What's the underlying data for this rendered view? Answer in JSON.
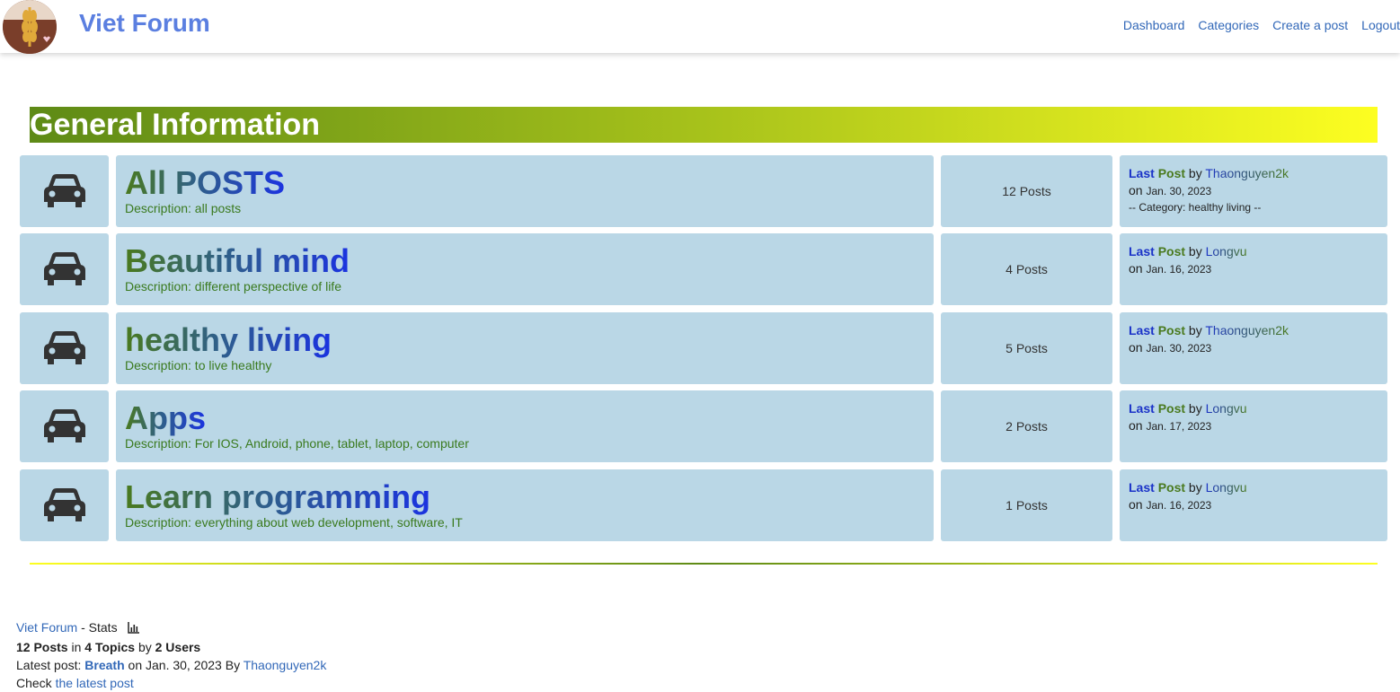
{
  "nav": {
    "brand": "Viet Forum",
    "links": [
      "Dashboard",
      "Categories",
      "Create a post",
      "Logout"
    ]
  },
  "section": {
    "title": "General Information"
  },
  "categories": [
    {
      "title": "All POSTS",
      "description": "Description: all posts",
      "count": "12 Posts",
      "last_label": "Last Post",
      "by": "by",
      "user": "Thaonguyen2k",
      "on": "on",
      "date": "Jan. 30, 2023",
      "extra": "-- Category: healthy living --"
    },
    {
      "title": "Beautiful mind",
      "description": "Description: different perspective of life",
      "count": "4 Posts",
      "last_label": "Last Post",
      "by": "by",
      "user": "Longvu",
      "on": "on",
      "date": "Jan. 16, 2023",
      "extra": ""
    },
    {
      "title": "healthy living",
      "description": "Description: to live healthy",
      "count": "5 Posts",
      "last_label": "Last Post",
      "by": "by",
      "user": "Thaonguyen2k",
      "on": "on",
      "date": "Jan. 30, 2023",
      "extra": ""
    },
    {
      "title": "Apps",
      "description": "Description: For IOS, Android, phone, tablet, laptop, computer",
      "count": "2 Posts",
      "last_label": "Last Post",
      "by": "by",
      "user": "Longvu",
      "on": "on",
      "date": "Jan. 17, 2023",
      "extra": ""
    },
    {
      "title": "Learn programming",
      "description": "Description: everything about web development, software, IT",
      "count": "1 Posts",
      "last_label": "Last Post",
      "by": "by",
      "user": "Longvu",
      "on": "on",
      "date": "Jan. 16, 2023",
      "extra": ""
    }
  ],
  "footer": {
    "site_link": "Viet Forum",
    "stats_label": "- Stats",
    "posts": "12 Posts",
    "in": "in",
    "topics": "4 Topics",
    "by": "by",
    "users": "2 Users",
    "latest_prefix": "Latest post:",
    "latest_title": "Breath",
    "latest_on": "on Jan. 30, 2023 By",
    "latest_user": "Thaonguyen2k",
    "check_prefix": "Check",
    "check_link": "the latest post"
  },
  "colors": {
    "brand": "#5b7fe0",
    "link": "#3268b8",
    "card": "#bad7e6"
  }
}
